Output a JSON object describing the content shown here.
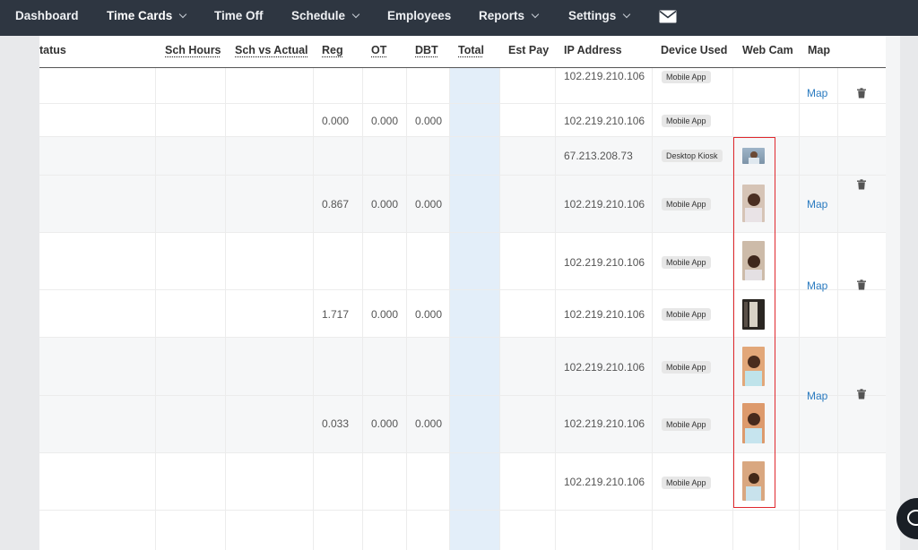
{
  "nav": {
    "items": [
      {
        "label": "Dashboard",
        "dropdown": false
      },
      {
        "label": "Time Cards",
        "dropdown": true,
        "active": true
      },
      {
        "label": "Time Off",
        "dropdown": false
      },
      {
        "label": "Schedule",
        "dropdown": true
      },
      {
        "label": "Employees",
        "dropdown": false
      },
      {
        "label": "Reports",
        "dropdown": true
      },
      {
        "label": "Settings",
        "dropdown": true
      }
    ],
    "mail_icon": "mail-icon",
    "bar_color": "#2e3641"
  },
  "table": {
    "headers": {
      "status": "tatus",
      "sch_hours": "Sch Hours",
      "sch_vs_actual": "Sch vs Actual",
      "reg": "Reg",
      "ot": "OT",
      "dbt": "DBT",
      "total": "Total",
      "est_pay": "Est Pay",
      "ip_address": "IP Address",
      "device_used": "Device Used",
      "web_cam": "Web Cam",
      "map": "Map"
    },
    "rows": [
      {
        "ip": "102.219.210.106",
        "device": "Mobile App",
        "reg": "",
        "ot": "",
        "dbt": ""
      },
      {
        "ip": "102.219.210.106",
        "device": "Mobile App",
        "reg": "0.000",
        "ot": "0.000",
        "dbt": "0.000"
      },
      {
        "ip": "67.213.208.73",
        "device": "Desktop Kiosk",
        "reg": "",
        "ot": "",
        "dbt": ""
      },
      {
        "ip": "102.219.210.106",
        "device": "Mobile App",
        "reg": "0.867",
        "ot": "0.000",
        "dbt": "0.000"
      },
      {
        "ip": "102.219.210.106",
        "device": "Mobile App",
        "reg": "",
        "ot": "",
        "dbt": ""
      },
      {
        "ip": "102.219.210.106",
        "device": "Mobile App",
        "reg": "1.717",
        "ot": "0.000",
        "dbt": "0.000"
      },
      {
        "ip": "102.219.210.106",
        "device": "Mobile App",
        "reg": "",
        "ot": "",
        "dbt": ""
      },
      {
        "ip": "102.219.210.106",
        "device": "Mobile App",
        "reg": "0.033",
        "ot": "0.000",
        "dbt": "0.000"
      },
      {
        "ip": "102.219.210.106",
        "device": "Mobile App",
        "reg": "",
        "ot": "",
        "dbt": ""
      }
    ],
    "map_link_label": "Map",
    "trash_icon": "trash-icon",
    "webcam_icon": "webcam-photo"
  },
  "colors": {
    "accent_link": "#2b7bc0",
    "highlight": "#e0282e",
    "total_column": "#e3eef9"
  },
  "chat_icon": "chat-icon"
}
